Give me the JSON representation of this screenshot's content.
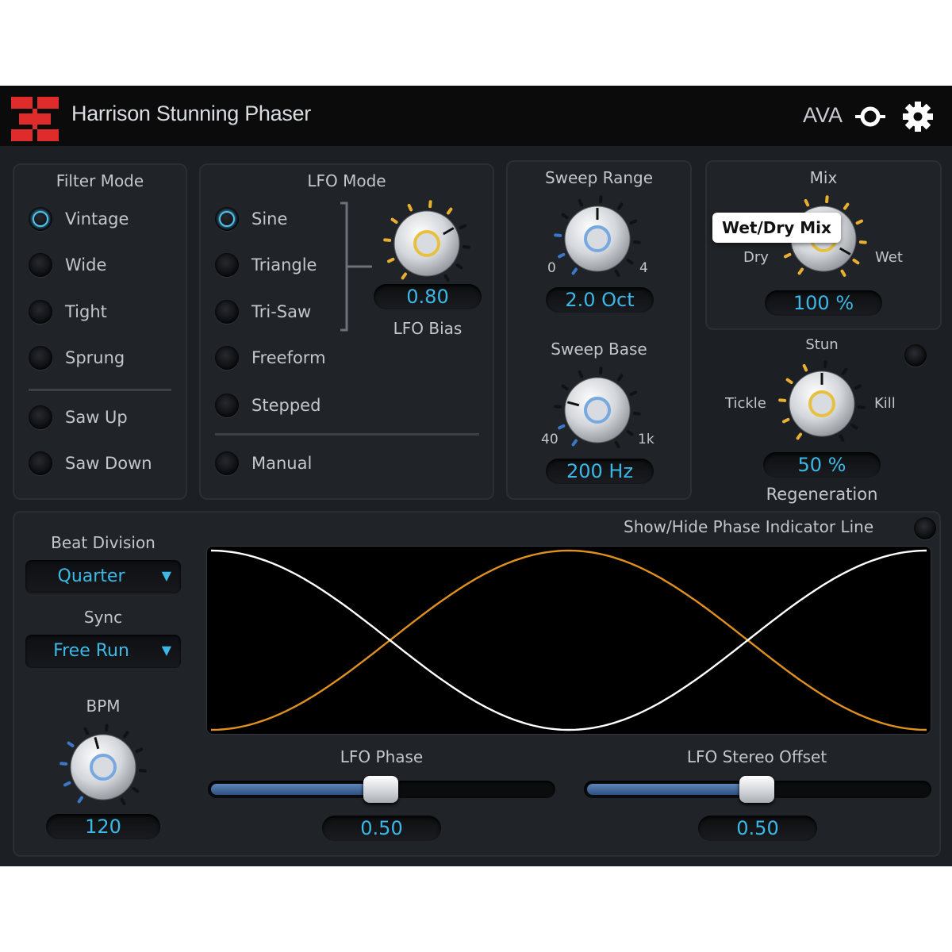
{
  "app": {
    "title": "Harrison Stunning Phaser",
    "brand": "AVA",
    "accent_color": "#3cb8e6",
    "logo_color": "#e02b2b"
  },
  "header": {
    "icons": [
      "ava-link-icon",
      "gear-icon"
    ]
  },
  "filter_mode": {
    "title": "Filter Mode",
    "options": [
      "Vintage",
      "Wide",
      "Tight",
      "Sprung"
    ],
    "options_extra": [
      "Saw Up",
      "Saw Down"
    ],
    "selected": "Vintage"
  },
  "lfo_mode": {
    "title": "LFO Mode",
    "options": [
      "Sine",
      "Triangle",
      "Tri-Saw",
      "Freeform",
      "Stepped"
    ],
    "options_extra": [
      "Manual"
    ],
    "selected": "Sine",
    "bias": {
      "label": "LFO Bias",
      "value": "0.80"
    }
  },
  "sweep_range": {
    "title": "Sweep Range",
    "min": "0",
    "max": "4",
    "value": "2.0 Oct"
  },
  "sweep_base": {
    "title": "Sweep Base",
    "min": "40",
    "max": "1k",
    "value": "200 Hz"
  },
  "mix": {
    "title": "Mix",
    "left": "Dry",
    "right": "Wet",
    "value": "100 %",
    "tooltip": "Wet/Dry Mix"
  },
  "regeneration": {
    "title": "Regeneration",
    "top": "Stun",
    "left": "Tickle",
    "right": "Kill",
    "value": "50 %"
  },
  "beat_division": {
    "label": "Beat Division",
    "value": "Quarter"
  },
  "sync": {
    "label": "Sync",
    "value": "Free Run"
  },
  "bpm": {
    "label": "BPM",
    "value": "120"
  },
  "phase_indicator": {
    "label": "Show/Hide Phase Indicator Line"
  },
  "lfo_phase": {
    "label": "LFO Phase",
    "value": "0.50",
    "fraction": 0.5
  },
  "lfo_stereo_offset": {
    "label": "LFO Stereo Offset",
    "value": "0.50",
    "fraction": 0.5
  },
  "waveform": {
    "left_color": "#ffffff",
    "right_color": "#e0901c",
    "cycles": 1
  }
}
